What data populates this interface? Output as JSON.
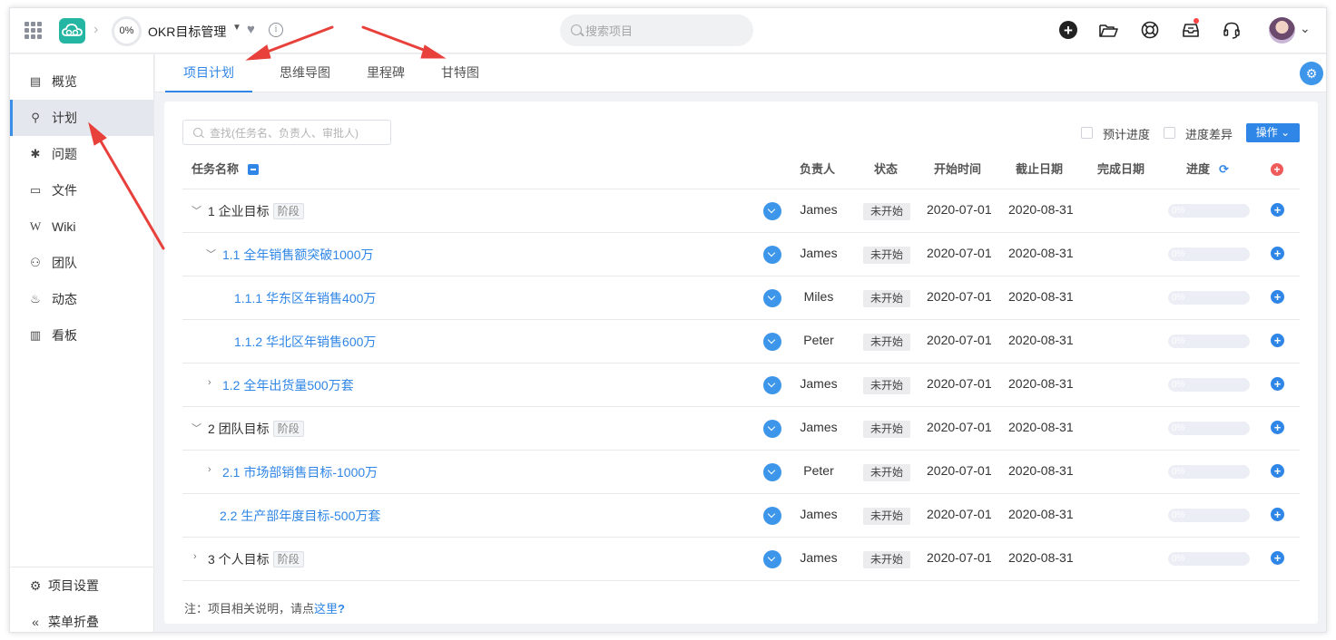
{
  "header": {
    "progress": "0%",
    "project_name": "OKR目标管理",
    "search_placeholder": "搜索项目",
    "icons": [
      "grid-icon",
      "app-logo",
      "heart-icon",
      "info-icon",
      "add-icon",
      "folder-icon",
      "help-icon",
      "inbox-icon",
      "headset-icon",
      "avatar"
    ]
  },
  "sidebar": {
    "items": [
      {
        "label": "概览",
        "icon": "▤"
      },
      {
        "label": "计划",
        "icon": "⚲"
      },
      {
        "label": "问题",
        "icon": "✱"
      },
      {
        "label": "文件",
        "icon": "▭"
      },
      {
        "label": "Wiki",
        "icon": "W"
      },
      {
        "label": "团队",
        "icon": "⚇"
      },
      {
        "label": "动态",
        "icon": "♨"
      },
      {
        "label": "看板",
        "icon": "▥"
      }
    ],
    "active_index": 1,
    "bottom": [
      {
        "label": "项目设置",
        "icon": "⚙"
      },
      {
        "label": "菜单折叠",
        "icon": "«"
      }
    ]
  },
  "tabs": [
    {
      "label": "项目计划",
      "active": true
    },
    {
      "label": "思维导图",
      "active": false
    },
    {
      "label": "里程碑",
      "active": false
    },
    {
      "label": "甘特图",
      "active": false
    }
  ],
  "toolbar": {
    "filter_placeholder": "查找(任务名、负责人、审批人)",
    "check_estimated": "预计进度",
    "check_diff": "进度差异",
    "ops_label": "操作"
  },
  "table": {
    "columns": {
      "name": "任务名称",
      "owner": "负责人",
      "status": "状态",
      "start": "开始时间",
      "due": "截止日期",
      "done": "完成日期",
      "progress": "进度"
    },
    "rows": [
      {
        "title": "1 企业目标",
        "stage": "阶段",
        "owner": "James",
        "status": "未开始",
        "start": "2020-07-01",
        "due": "2020-08-31",
        "done": "",
        "progress": "0%"
      },
      {
        "title": "1.1 全年销售额突破1000万",
        "stage": "",
        "owner": "James",
        "status": "未开始",
        "start": "2020-07-01",
        "due": "2020-08-31",
        "done": "",
        "progress": "0%"
      },
      {
        "title": "1.1.1 华东区年销售400万",
        "stage": "",
        "owner": "Miles",
        "status": "未开始",
        "start": "2020-07-01",
        "due": "2020-08-31",
        "done": "",
        "progress": "0%"
      },
      {
        "title": "1.1.2 华北区年销售600万",
        "stage": "",
        "owner": "Peter",
        "status": "未开始",
        "start": "2020-07-01",
        "due": "2020-08-31",
        "done": "",
        "progress": "0%"
      },
      {
        "title": "1.2 全年出货量500万套",
        "stage": "",
        "owner": "James",
        "status": "未开始",
        "start": "2020-07-01",
        "due": "2020-08-31",
        "done": "",
        "progress": "0%"
      },
      {
        "title": "2 团队目标",
        "stage": "阶段",
        "owner": "James",
        "status": "未开始",
        "start": "2020-07-01",
        "due": "2020-08-31",
        "done": "",
        "progress": "0%"
      },
      {
        "title": "2.1 市场部销售目标-1000万",
        "stage": "",
        "owner": "Peter",
        "status": "未开始",
        "start": "2020-07-01",
        "due": "2020-08-31",
        "done": "",
        "progress": "0%"
      },
      {
        "title": "2.2 生产部年度目标-500万套",
        "stage": "",
        "owner": "James",
        "status": "未开始",
        "start": "2020-07-01",
        "due": "2020-08-31",
        "done": "",
        "progress": "0%"
      },
      {
        "title": "3 个人目标",
        "stage": "阶段",
        "owner": "James",
        "status": "未开始",
        "start": "2020-07-01",
        "due": "2020-08-31",
        "done": "",
        "progress": "0%"
      }
    ]
  },
  "note": {
    "prefix": "注：项目相关说明，请点",
    "link": "这里",
    "q": "?"
  },
  "colors": {
    "accent": "#2f86e6",
    "logo": "#25b5a3",
    "annotation_arrow": "#e8403a"
  }
}
